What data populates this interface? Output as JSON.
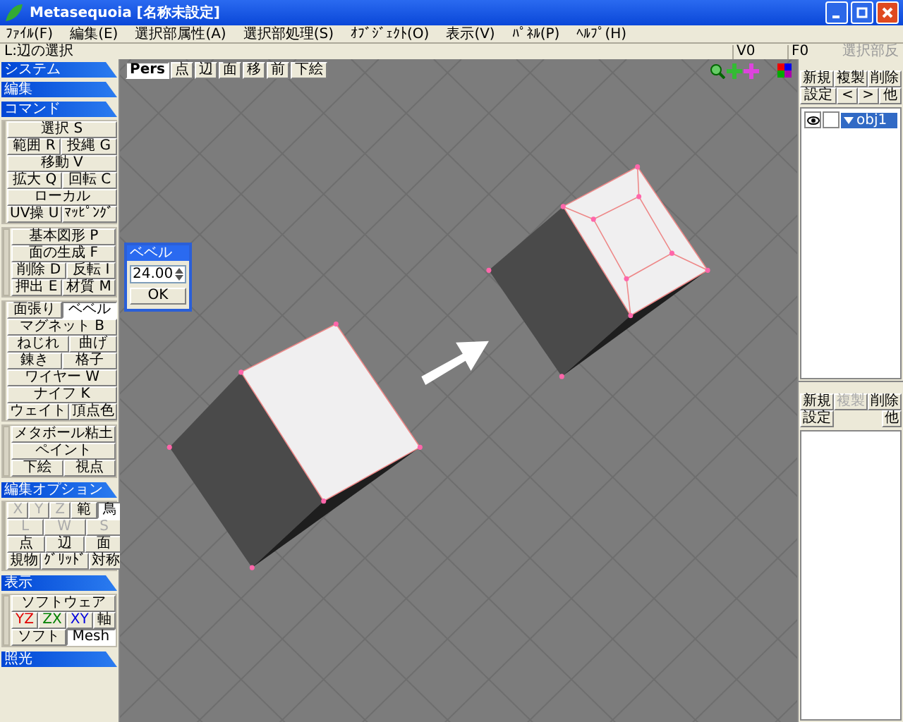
{
  "window": {
    "title": "Metasequoia [名称未設定]"
  },
  "menu": [
    "ﾌｧｲﾙ(F)",
    "編集(E)",
    "選択部属性(A)",
    "選択部処理(S)",
    "ｵﾌﾞｼﾞｪｸﾄ(O)",
    "表示(V)",
    "ﾊﾟﾈﾙ(P)",
    "ﾍﾙﾌﾟ(H)"
  ],
  "status": {
    "message": "L:辺の選択",
    "vertex_count": "V0",
    "face_count": "F0",
    "selection_button": "選択部反"
  },
  "left_panel": [
    {
      "title": "システム"
    },
    {
      "title": "編集"
    },
    {
      "title": "コマンド",
      "groups": [
        [
          [
            {
              "label": "選択 S",
              "selected": false,
              "disabled": false
            }
          ],
          [
            {
              "label": "範囲 R",
              "selected": false,
              "disabled": false
            },
            {
              "label": "投縄 G",
              "selected": false,
              "disabled": false
            }
          ],
          [
            {
              "label": "移動 V",
              "selected": false,
              "disabled": false
            }
          ],
          [
            {
              "label": "拡大 Q",
              "selected": false,
              "disabled": false
            },
            {
              "label": "回転 C",
              "selected": false,
              "disabled": false
            }
          ],
          [
            {
              "label": "ローカル",
              "selected": false,
              "disabled": false
            }
          ],
          [
            {
              "label": "UV操 U",
              "selected": false,
              "disabled": false
            },
            {
              "label": "ﾏｯﾋﾟﾝｸﾞ",
              "selected": false,
              "disabled": false
            }
          ]
        ],
        [
          [
            {
              "label": "基本図形 P",
              "selected": false,
              "disabled": false
            }
          ],
          [
            {
              "label": "面の生成 F",
              "selected": false,
              "disabled": false
            }
          ],
          [
            {
              "label": "削除 D",
              "selected": false,
              "disabled": false
            },
            {
              "label": "反転 I",
              "selected": false,
              "disabled": false
            }
          ],
          [
            {
              "label": "押出 E",
              "selected": false,
              "disabled": false
            },
            {
              "label": "材質 M",
              "selected": false,
              "disabled": false
            }
          ]
        ],
        [
          [
            {
              "label": "面張り",
              "selected": false,
              "disabled": false
            },
            {
              "label": "ベベル",
              "selected": true,
              "disabled": false
            }
          ],
          [
            {
              "label": "マグネット B",
              "selected": false,
              "disabled": false
            }
          ],
          [
            {
              "label": "ねじれ",
              "selected": false,
              "disabled": false
            },
            {
              "label": "曲げ",
              "selected": false,
              "disabled": false
            }
          ],
          [
            {
              "label": "錬き",
              "selected": false,
              "disabled": false
            },
            {
              "label": "格子",
              "selected": false,
              "disabled": false
            }
          ],
          [
            {
              "label": "ワイヤー W",
              "selected": false,
              "disabled": false
            }
          ],
          [
            {
              "label": "ナイフ K",
              "selected": false,
              "disabled": false
            }
          ],
          [
            {
              "label": "ウェイト",
              "selected": false,
              "disabled": false
            },
            {
              "label": "頂点色",
              "selected": false,
              "disabled": false
            }
          ]
        ],
        [
          [
            {
              "label": "メタボール粘土",
              "selected": false,
              "disabled": false
            }
          ],
          [
            {
              "label": "ペイント",
              "selected": false,
              "disabled": false
            }
          ],
          [
            {
              "label": "下絵",
              "selected": false,
              "disabled": false
            },
            {
              "label": "視点",
              "selected": false,
              "disabled": false
            }
          ]
        ]
      ]
    },
    {
      "title": "編集オプション",
      "groups": [
        [
          [
            {
              "label": "X",
              "selected": false,
              "disabled": true
            },
            {
              "label": "Y",
              "selected": false,
              "disabled": true
            },
            {
              "label": "Z",
              "selected": false,
              "disabled": true
            },
            {
              "label": "範",
              "selected": false,
              "disabled": false
            },
            {
              "label": "鳥",
              "selected": true,
              "disabled": false
            }
          ],
          [
            {
              "label": "L",
              "selected": false,
              "disabled": true
            },
            {
              "label": "W",
              "selected": false,
              "disabled": true
            },
            {
              "label": "S",
              "selected": false,
              "disabled": true
            }
          ],
          [
            {
              "label": "点",
              "selected": false,
              "disabled": false
            },
            {
              "label": "辺",
              "selected": false,
              "disabled": false
            },
            {
              "label": "面",
              "selected": false,
              "disabled": false
            }
          ],
          [
            {
              "label": "規物",
              "selected": false,
              "disabled": false
            },
            {
              "label": "ｸﾞﾘｯﾄﾞ",
              "selected": false,
              "disabled": false
            },
            {
              "label": "対称",
              "selected": false,
              "disabled": false
            }
          ]
        ]
      ]
    },
    {
      "title": "表示",
      "groups": [
        [
          [
            {
              "label": "ソフトウェア",
              "selected": false,
              "disabled": false
            }
          ],
          [
            {
              "label": "YZ",
              "selected": false,
              "disabled": false,
              "color": "#e00000"
            },
            {
              "label": "ZX",
              "selected": false,
              "disabled": false,
              "color": "#008000"
            },
            {
              "label": "XY",
              "selected": false,
              "disabled": false,
              "color": "#0000e0"
            },
            {
              "label": "軸",
              "selected": false,
              "disabled": false
            }
          ],
          [
            {
              "label": "ソフト",
              "selected": false,
              "disabled": false
            },
            {
              "label": "Mesh",
              "selected": true,
              "disabled": false
            }
          ]
        ]
      ]
    },
    {
      "title": "照光"
    }
  ],
  "viewport_toolbar": [
    {
      "label": "Pers",
      "selected": true
    },
    {
      "label": "点",
      "selected": false
    },
    {
      "label": "辺",
      "selected": false
    },
    {
      "label": "面",
      "selected": false
    },
    {
      "label": "移",
      "selected": false
    },
    {
      "label": "前",
      "selected": false
    },
    {
      "label": "下絵",
      "selected": false
    }
  ],
  "bevel_dialog": {
    "title": "ベベル",
    "value": "24.00",
    "button": "OK"
  },
  "object_panel": {
    "buttons": [
      [
        {
          "label": "新規",
          "disabled": false
        },
        {
          "label": "複製",
          "disabled": false
        },
        {
          "label": "削除",
          "disabled": false
        }
      ],
      [
        {
          "label": "設定",
          "disabled": false
        },
        {
          "label": "<",
          "disabled": false
        },
        {
          "label": ">",
          "disabled": false
        },
        {
          "label": "他",
          "disabled": false
        }
      ]
    ],
    "objects": [
      {
        "name": "obj1",
        "visible": true,
        "locked": false,
        "selected": true
      }
    ]
  },
  "material_panel": {
    "buttons": [
      [
        {
          "label": "新規",
          "disabled": false
        },
        {
          "label": "複製",
          "disabled": true
        },
        {
          "label": "削除",
          "disabled": false
        }
      ],
      [
        {
          "label": "設定",
          "disabled": false
        },
        {
          "label": "他",
          "disabled": false
        }
      ]
    ]
  }
}
